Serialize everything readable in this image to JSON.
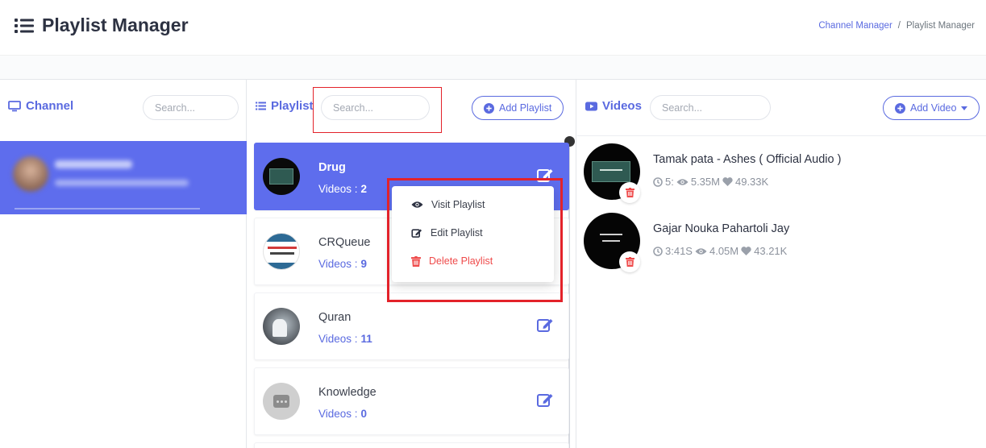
{
  "header": {
    "title": "Playlist Manager",
    "breadcrumb": {
      "link": "Channel Manager",
      "separator": "/",
      "current": "Playlist Manager"
    }
  },
  "channel_column": {
    "title": "Channel",
    "search_placeholder": "Search..."
  },
  "playlist_column": {
    "title": "Playlist",
    "search_placeholder": "Search...",
    "add_button": "Add Playlist",
    "count_label": "Videos :",
    "playlists": [
      {
        "name": "Drug",
        "count": "2"
      },
      {
        "name": "CRQueue",
        "count": "9"
      },
      {
        "name": "Quran",
        "count": "11"
      },
      {
        "name": "Knowledge",
        "count": "0"
      }
    ]
  },
  "context_menu": {
    "visit": "Visit Playlist",
    "edit": "Edit Playlist",
    "delete": "Delete Playlist"
  },
  "videos_column": {
    "title": "Videos",
    "search_placeholder": "Search...",
    "add_button": "Add Video",
    "videos": [
      {
        "title": "Tamak pata - Ashes ( Official Audio )",
        "duration": "5:",
        "views": "5.35M",
        "likes": "49.33K"
      },
      {
        "title": "Gajar Nouka Pahartoli Jay",
        "duration": "3:41S",
        "views": "4.05M",
        "likes": "43.21K"
      }
    ]
  },
  "colors": {
    "accent": "#5e6ded",
    "danger": "#ef4b4b",
    "highlight": "#e3222a"
  }
}
